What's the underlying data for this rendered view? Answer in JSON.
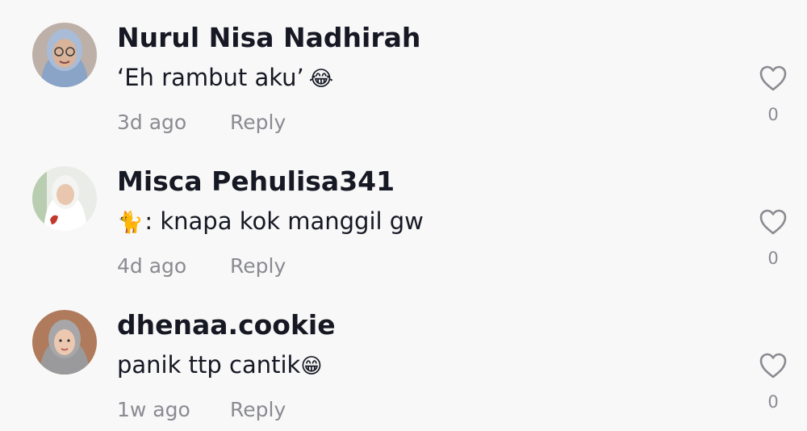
{
  "comments": [
    {
      "username": "Nurul Nisa Nadhirah",
      "text": "‘Eh rambut aku’",
      "emoji": "😂",
      "time": "3d ago",
      "reply_label": "Reply",
      "likes": "0"
    },
    {
      "username": "Misca Pehulisa341",
      "emoji": "🐈",
      "text": ": knapa kok manggil gw",
      "time": "4d ago",
      "reply_label": "Reply",
      "likes": "0"
    },
    {
      "username": "dhenaa.cookie",
      "text": "panik ttp cantik",
      "emoji": "😁",
      "time": "1w ago",
      "reply_label": "Reply",
      "likes": "0"
    }
  ],
  "icons": {
    "like": "heart-outline-icon"
  },
  "colors": {
    "background": "#f8f8f8",
    "username": "#161823",
    "secondary": "#8a8b91"
  }
}
